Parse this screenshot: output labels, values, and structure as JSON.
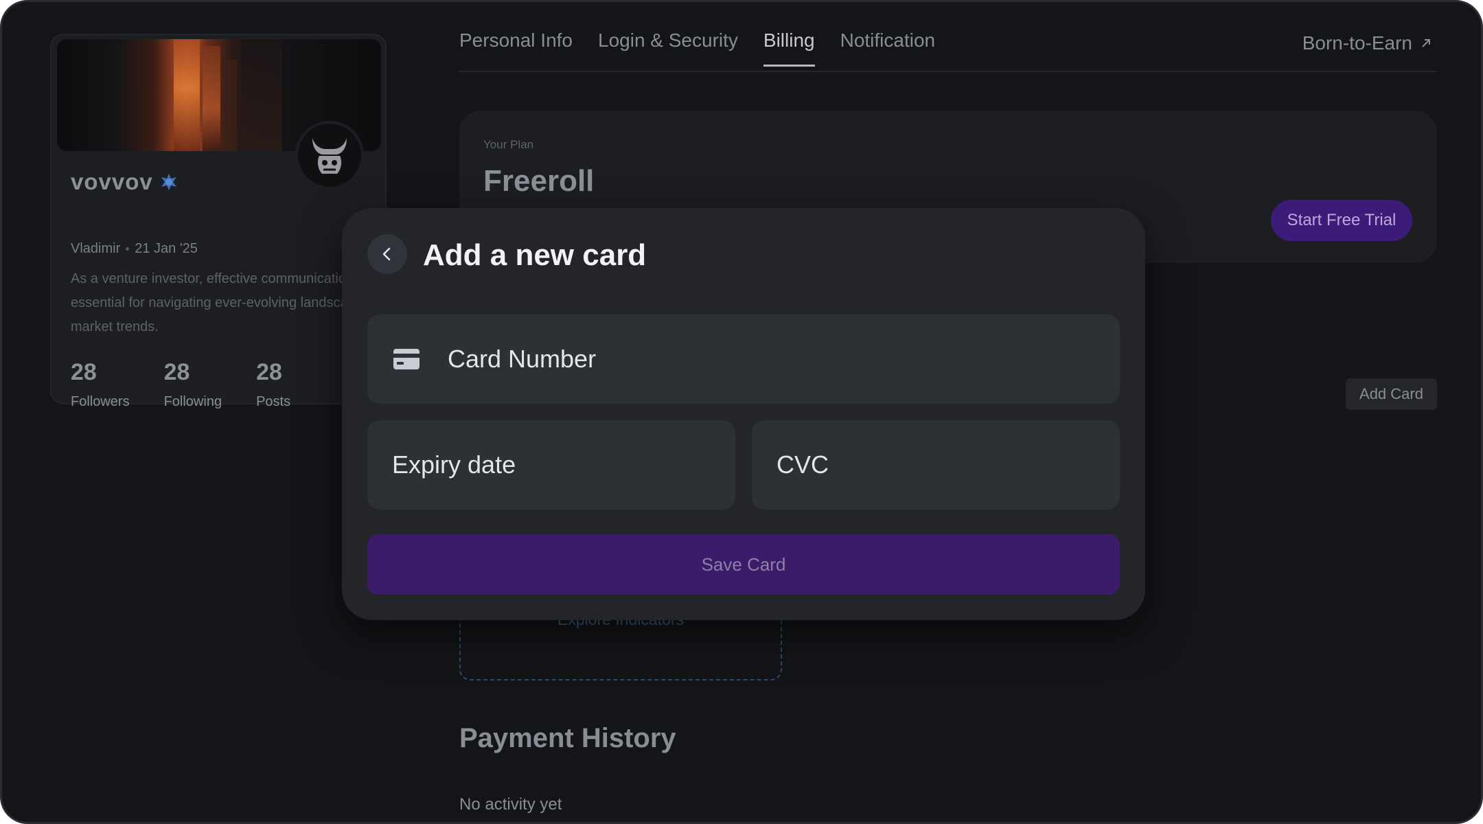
{
  "profile": {
    "username": "vovvov",
    "name": "Vladimir",
    "date": "21 Jan '25",
    "bio": "As a venture investor, effective communication is essential for navigating ever-evolving landscape of market trends.",
    "stats": [
      {
        "value": "28",
        "label": "Followers"
      },
      {
        "value": "28",
        "label": "Following"
      },
      {
        "value": "28",
        "label": "Posts"
      }
    ]
  },
  "tabs": [
    {
      "label": "Personal Info"
    },
    {
      "label": "Login & Security"
    },
    {
      "label": "Billing"
    },
    {
      "label": "Notification"
    }
  ],
  "header": {
    "external_link": "Born-to-Earn"
  },
  "plan": {
    "label": "Your Plan",
    "name": "Freeroll",
    "trial_button": "Start Free Trial"
  },
  "background": {
    "add_card_button": "Add Card",
    "explore_link": "Explore Indicators",
    "payment_history_title": "Payment History",
    "payment_history_empty": "No activity yet"
  },
  "modal": {
    "title": "Add a new card",
    "card_number_placeholder": "Card Number",
    "expiry_placeholder": "Expiry date",
    "cvc_placeholder": "CVC",
    "save_button": "Save Card"
  },
  "colors": {
    "background": "#141518",
    "modal": "#232529",
    "field": "#2d3035",
    "accent_purple": "#3d1b6b"
  },
  "icons": [
    "chevron-left-icon",
    "credit-card-icon",
    "verified-badge-icon",
    "bull-logo-icon",
    "external-arrow-icon"
  ]
}
